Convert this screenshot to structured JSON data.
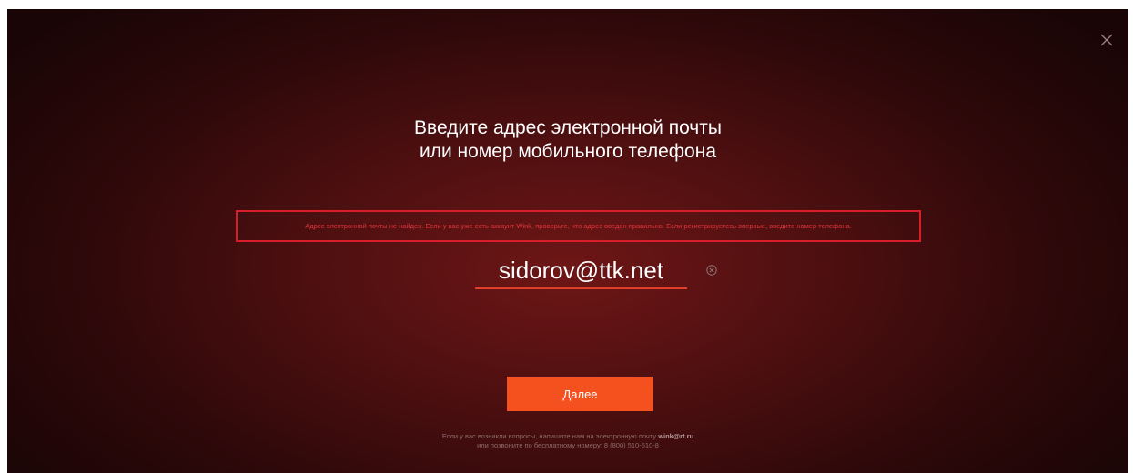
{
  "title": {
    "line1": "Введите адрес электронной почты",
    "line2": "или номер мобильного телефона"
  },
  "error": {
    "message": "Адрес электронной почты не найден. Если у вас уже есть аккаунт Wink, проверьте, что адрес введен правильно. Если регистрируетесь впервые, введите номер телефона."
  },
  "login": {
    "value": "sidorov@ttk.net"
  },
  "next_button": {
    "label": "Далее"
  },
  "footer": {
    "line1_text": "Если у вас возникли вопросы, напишите нам на электронную почту ",
    "email": "wink@rt.ru",
    "line2_text": "или позвоните по бесплатному номеру: 8 (800) 510-510-8"
  },
  "icons": {
    "close": "close-icon",
    "clear": "clear-input-icon"
  },
  "colors": {
    "accent": "#f4511e",
    "error": "#e4343a",
    "error_border": "#d81e2b",
    "background_center": "#6e1616",
    "background_edge": "#1a0506"
  }
}
